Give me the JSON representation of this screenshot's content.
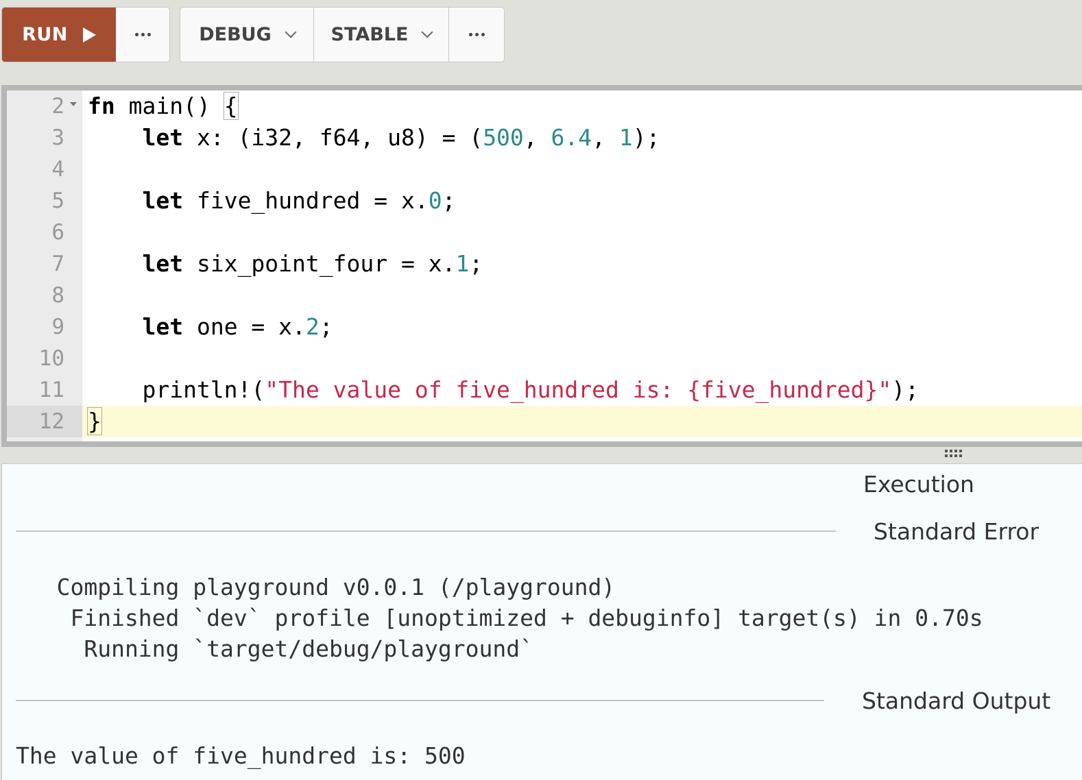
{
  "toolbar": {
    "run_label": "RUN",
    "run_icon": "play-icon",
    "more_icon": "ellipsis-icon",
    "mode_label": "DEBUG",
    "channel_label": "STABLE",
    "dropdown_icon": "chevron-down-icon"
  },
  "editor": {
    "active_line": "12",
    "lines": [
      {
        "num": "2",
        "text": "fn main() {"
      },
      {
        "num": "3",
        "text": "    let x: (i32, f64, u8) = (500, 6.4, 1);"
      },
      {
        "num": "4",
        "text": ""
      },
      {
        "num": "5",
        "text": "    let five_hundred = x.0;"
      },
      {
        "num": "6",
        "text": ""
      },
      {
        "num": "7",
        "text": "    let six_point_four = x.1;"
      },
      {
        "num": "8",
        "text": ""
      },
      {
        "num": "9",
        "text": "    let one = x.2;"
      },
      {
        "num": "10",
        "text": ""
      },
      {
        "num": "11",
        "text": "    println!(\"The value of five_hundred is: {five_hundred}\");"
      },
      {
        "num": "12",
        "text": "}"
      }
    ]
  },
  "output": {
    "execution_label": "Execution",
    "stderr_label": "Standard Error",
    "stderr_text": "   Compiling playground v0.0.1 (/playground)\n    Finished `dev` profile [unoptimized + debuginfo] target(s) in 0.70s\n     Running `target/debug/playground`",
    "stdout_label": "Standard Output",
    "stdout_text": "The value of five_hundred is: 500"
  },
  "colors": {
    "run_button": "#a54d30",
    "keyword": "#000000",
    "number": "#2b8a8a",
    "string": "#c9274a",
    "active_line": "#fdfbd6"
  }
}
